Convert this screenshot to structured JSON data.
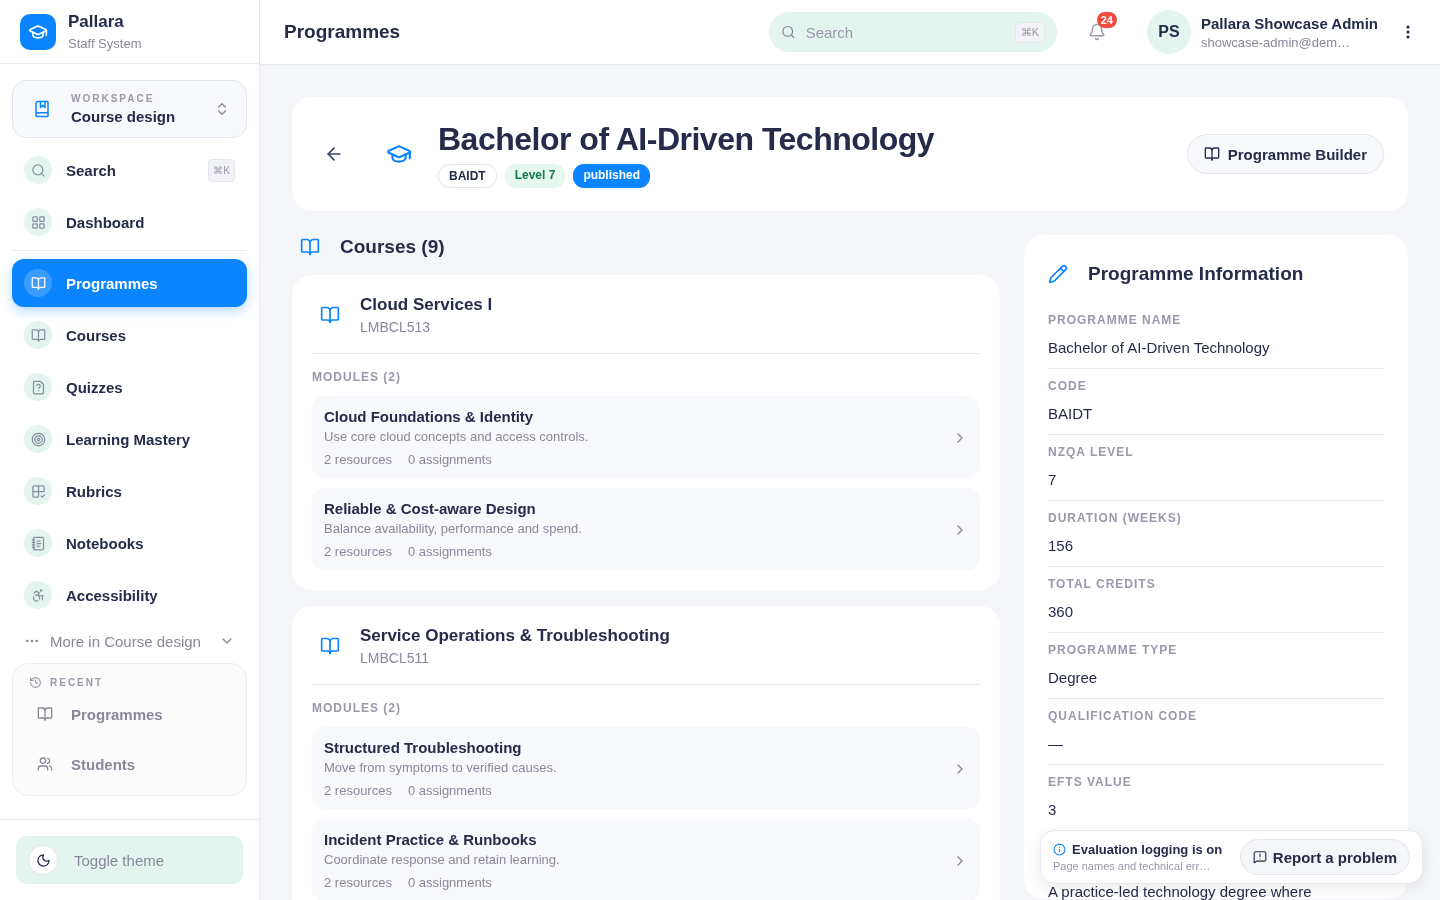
{
  "app": {
    "name": "Pallara",
    "subtitle": "Staff System"
  },
  "workspace": {
    "label": "WORKSPACE",
    "name": "Course design"
  },
  "sidebar": {
    "quick_items": [
      {
        "label": "Search",
        "shortcut": "⌘K",
        "selected": false
      },
      {
        "label": "Dashboard",
        "selected": false
      }
    ],
    "items": [
      {
        "label": "Programmes",
        "selected": true
      },
      {
        "label": "Courses",
        "selected": false
      },
      {
        "label": "Quizzes",
        "selected": false
      },
      {
        "label": "Learning Mastery",
        "selected": false
      },
      {
        "label": "Rubrics",
        "selected": false
      },
      {
        "label": "Notebooks",
        "selected": false
      },
      {
        "label": "Accessibility",
        "selected": false
      }
    ],
    "more": "More in Course design",
    "recent": {
      "title": "RECENT",
      "items": [
        "Programmes",
        "Students"
      ]
    },
    "toggle_theme": "Toggle theme"
  },
  "topbar": {
    "title": "Programmes",
    "search": {
      "placeholder": "Search",
      "shortcut": "⌘K"
    },
    "notifications": "24",
    "user": {
      "initials": "PS",
      "name": "Pallara Showcase Admin",
      "email": "showcase-admin@dem…"
    }
  },
  "programme": {
    "title": "Bachelor of AI-Driven Technology",
    "tags": [
      {
        "text": "BAIDT",
        "kind": "code"
      },
      {
        "text": "Level 7",
        "kind": "level"
      },
      {
        "text": "published",
        "kind": "status"
      }
    ],
    "builder_button": "Programme Builder"
  },
  "courses": {
    "heading": "Courses (9)",
    "items": [
      {
        "title": "Cloud Services I",
        "code": "LMBCL513",
        "modules_heading": "MODULES (2)",
        "modules": [
          {
            "title": "Cloud Foundations & Identity",
            "description": "Use core cloud concepts and access controls.",
            "resources": "2 resources",
            "assignments": "0 assignments"
          },
          {
            "title": "Reliable & Cost-aware Design",
            "description": "Balance availability, performance and spend.",
            "resources": "2 resources",
            "assignments": "0 assignments"
          }
        ]
      },
      {
        "title": "Service Operations & Troubleshooting",
        "code": "LMBCL511",
        "modules_heading": "MODULES (2)",
        "modules": [
          {
            "title": "Structured Troubleshooting",
            "description": "Move from symptoms to verified causes.",
            "resources": "2 resources",
            "assignments": "0 assignments"
          },
          {
            "title": "Incident Practice & Runbooks",
            "description": "Coordinate response and retain learning.",
            "resources": "2 resources",
            "assignments": "0 assignments"
          }
        ]
      }
    ]
  },
  "info": {
    "heading": "Programme Information",
    "fields": [
      {
        "label": "PROGRAMME NAME",
        "value": "Bachelor of AI-Driven Technology"
      },
      {
        "label": "CODE",
        "value": "BAIDT"
      },
      {
        "label": "NZQA LEVEL",
        "value": "7"
      },
      {
        "label": "DURATION (WEEKS)",
        "value": "156"
      },
      {
        "label": "TOTAL CREDITS",
        "value": "360"
      },
      {
        "label": "PROGRAMME TYPE",
        "value": "Degree"
      },
      {
        "label": "QUALIFICATION CODE",
        "value": "—"
      },
      {
        "label": "EFTS VALUE",
        "value": "3"
      }
    ],
    "description": "A practice-led technology degree where"
  },
  "toast": {
    "title": "Evaluation logging is on",
    "message": "Page names and technical err…",
    "button": "Report a problem"
  }
}
